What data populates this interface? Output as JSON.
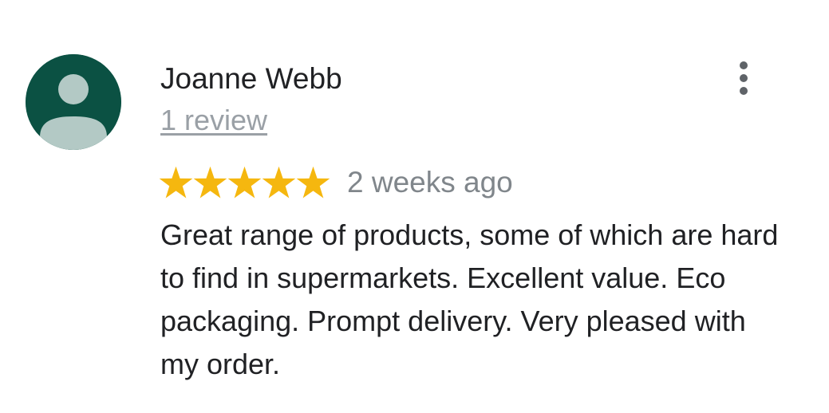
{
  "review": {
    "author_name": "Joanne Webb",
    "review_count": "1 review",
    "rating": 5,
    "rating_max": 5,
    "date": "2 weeks ago",
    "text": "Great range of products, some of which are hard to find in supermarkets. Excellent value. Eco packaging. Prompt delivery. Very pleased with my order."
  },
  "icons": {
    "avatar": "default-person-avatar",
    "menu": "more-vertical-icon",
    "star": "star-icon"
  },
  "colors": {
    "avatar_background": "#0b5143",
    "avatar_figure": "#b3c9c5",
    "star": "#f5b70f",
    "text_primary": "#202124",
    "text_secondary": "#80868b",
    "link": "#9aa0a6",
    "menu_dots": "#5f6368"
  }
}
